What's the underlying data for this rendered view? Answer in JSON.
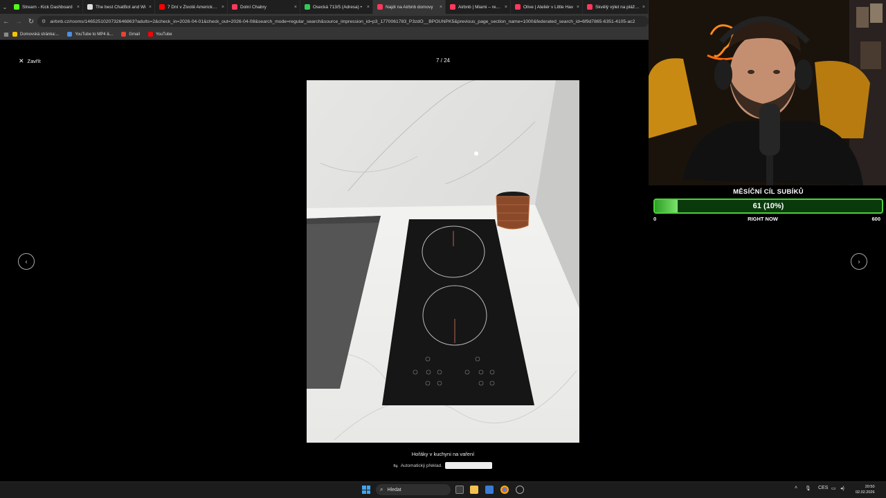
{
  "browser": {
    "tabs": [
      {
        "label": "Stream - Kick Dashboard",
        "color": "#53fc18",
        "active": false
      },
      {
        "label": "The best ChatBot and Wi",
        "color": "#dddddd",
        "active": false
      },
      {
        "label": "7 Dní v Životě Amerického",
        "color": "#ff0000",
        "active": false
      },
      {
        "label": "Dolní Chabry",
        "color": "#ff385c",
        "active": false
      },
      {
        "label": "Osecká 713/5 (Adresa) •",
        "color": "#34c759",
        "active": false
      },
      {
        "label": "Najdi na Airbnb domovy",
        "color": "#ff385c",
        "active": true
      },
      {
        "label": "Airbnb | Miami – rekreačr",
        "color": "#ff385c",
        "active": false
      },
      {
        "label": "Olive | Ateliér v Little Hav",
        "color": "#ff385c",
        "active": false
      },
      {
        "label": "Skvělý výlet na pláž - By",
        "color": "#ff385c",
        "active": false
      }
    ],
    "tab_close": "×",
    "url": "airbnb.cz/rooms/1465251020732646863?adults=2&check_in=2026-04-01&check_out=2026-04-08&search_mode=regular_search&source_impression_id=p3_1770061783_P3zdO__BPOUNPK5&previous_page_section_name=1000&federated_search_id=6f9d7865-6351-4105-ac2",
    "bookmarks": [
      {
        "label": "Domovská stránka:...",
        "color": "#f5c400"
      },
      {
        "label": "YouTube to MP4 &...",
        "color": "#4a90e2"
      },
      {
        "label": "Gmail",
        "color": "#ea4335"
      },
      {
        "label": "YouTube",
        "color": "#ff0000"
      }
    ]
  },
  "viewer": {
    "close_label": "Zavřít",
    "counter": "7 / 24",
    "caption": "Hořáky v kuchyni na vaření",
    "auto_translate": "Automatický překlad.",
    "prev_icon": "chevron-left-icon",
    "next_icon": "chevron-right-icon"
  },
  "goal": {
    "title": "MĚSÍČNÍ CÍL SUBÍKŮ",
    "current_label": "61 (10%)",
    "progress": 0.1,
    "min_label": "0",
    "mid_label": "RIGHT NOW",
    "max_label": "600"
  },
  "taskbar": {
    "search_placeholder": "Hledat",
    "lang": "CES",
    "time": "20:50",
    "date": "02.02.2026"
  },
  "colors": {
    "goal_border": "#4cd13c",
    "goal_fill": "#7be36b",
    "windows_blue": "#3ea6f2"
  }
}
